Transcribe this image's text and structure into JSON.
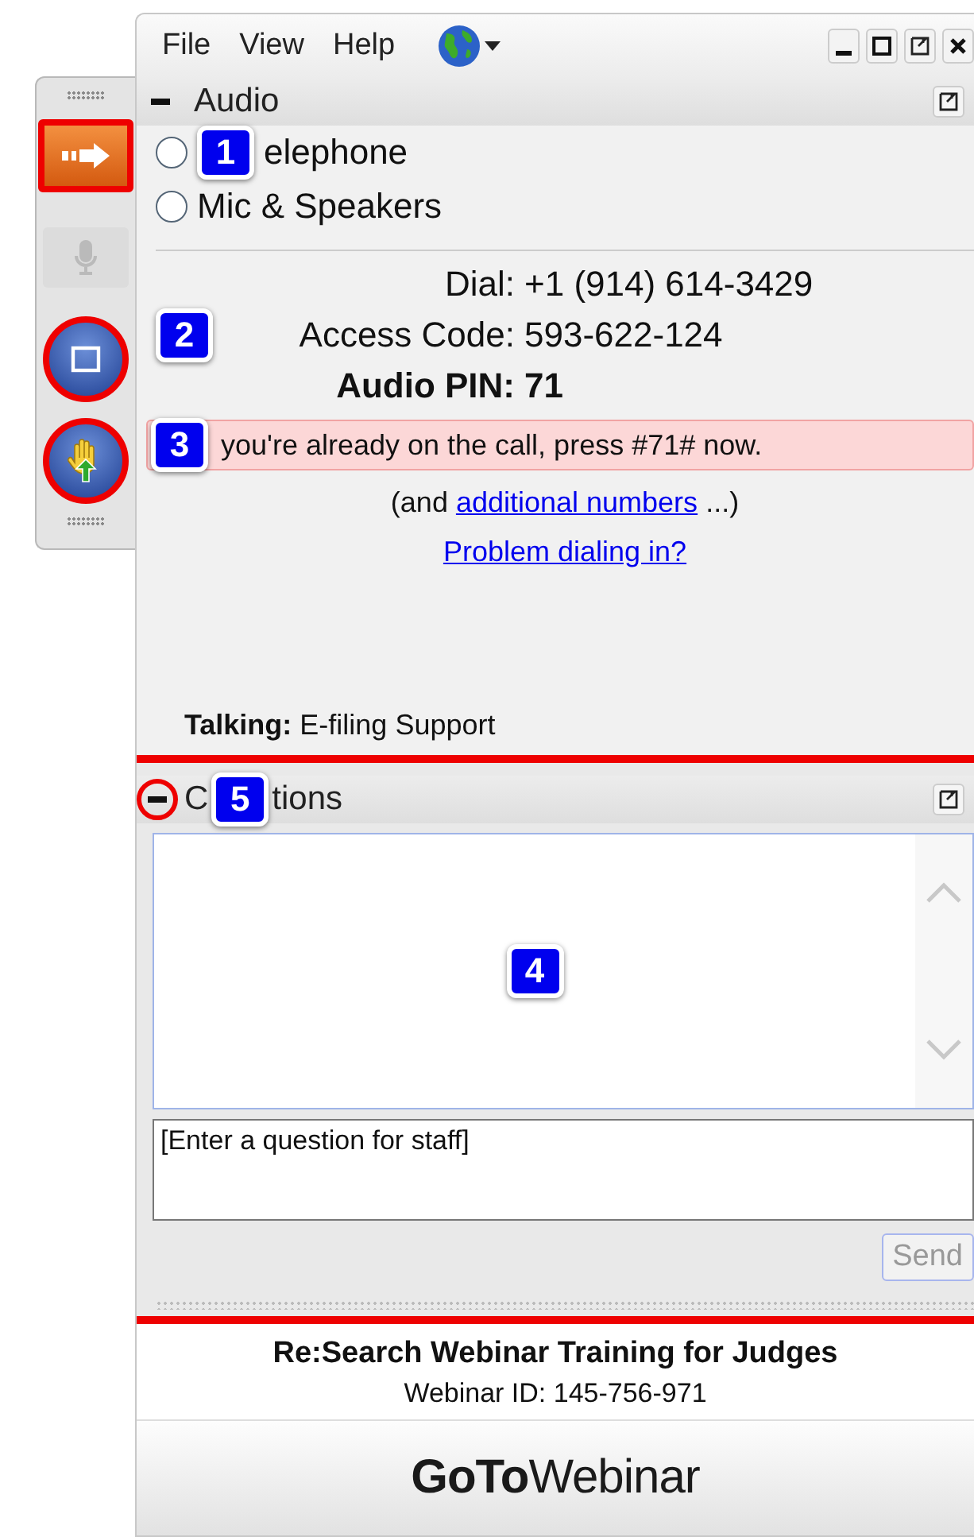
{
  "menu": [
    {
      "label": "File"
    },
    {
      "label": "View"
    },
    {
      "label": "Help"
    }
  ],
  "toolbar": [
    {
      "kind": "arrow",
      "disabled": false,
      "highlighted": true
    },
    {
      "kind": "mic",
      "disabled": true,
      "highlighted": false
    },
    {
      "kind": "screen",
      "disabled": false,
      "highlighted": true
    },
    {
      "kind": "hand",
      "disabled": false,
      "highlighted": true
    }
  ],
  "audio": {
    "title": "Audio",
    "options": [
      {
        "label": "elephone",
        "selected": false,
        "callout": "1"
      },
      {
        "label": "Mic & Speakers",
        "selected": false
      }
    ],
    "details": [
      {
        "label": "Dial:",
        "value": "+1 (914) 614-3429",
        "bold": false
      },
      {
        "label": "Access Code:",
        "value": "593-622-124",
        "bold": false,
        "callout": "2"
      },
      {
        "label": "Audio PIN:",
        "value": "71",
        "bold": true
      }
    ],
    "notice": {
      "text": "you're already on the call, press #71# now.",
      "callout": "3"
    },
    "more_numbers": {
      "before": "(and ",
      "link": "additional numbers",
      "after": " ...)"
    },
    "problem_link": "Problem dialing in?",
    "talking": "**Talking:** E-filing Support"
  },
  "questions": {
    "highlighted": true,
    "title_start": "C",
    "title_end": "tions",
    "callout": "5",
    "collapse_highlighted": true,
    "log_callout": "4",
    "placeholder": "[Enter a question for staff]",
    "send": "Send",
    "send_disabled": true
  },
  "footer": {
    "title": "Re:Search Webinar Training for Judges",
    "webinar_id": "Webinar ID: 145-756-971"
  },
  "brand": "**GoTo**Webinar"
}
